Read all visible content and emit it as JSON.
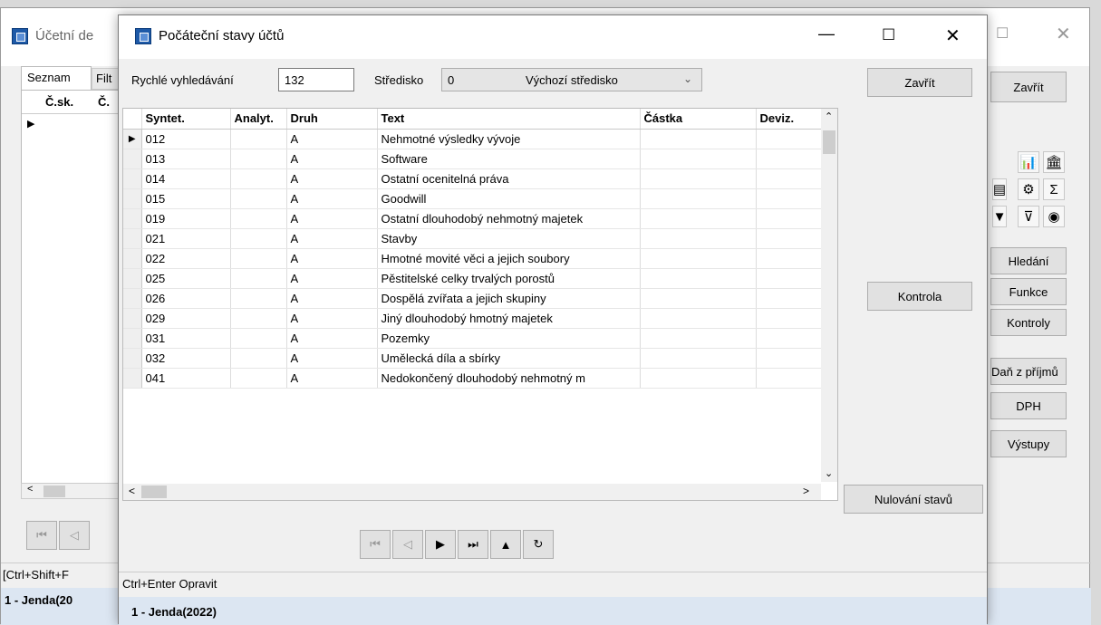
{
  "back_window": {
    "title": "Účetní de",
    "tabs": [
      "Seznam",
      "Filt"
    ],
    "col_headers": [
      "Č.sk.",
      "Č."
    ],
    "close_label": "Zavřít",
    "buttons": [
      "Hledání",
      "Funkce",
      "Kontroly",
      "Daň z příjmů",
      "DPH",
      "Výstupy"
    ],
    "status_hint": "[Ctrl+Shift+F",
    "status_user": "1 - Jenda(20",
    "icons": [
      "bar-chart-icon",
      "bank-icon",
      "list-icon",
      "gear-icon",
      "sum-icon",
      "filter-icon",
      "clear-filter-icon",
      "eye-icon"
    ]
  },
  "dialog": {
    "title": "Počáteční stavy účtů",
    "search_label": "Rychlé vyhledávání",
    "search_value": "132",
    "stredisko_label": "Středisko",
    "stredisko_code": "0",
    "stredisko_name": "Výchozí středisko",
    "close_label": "Zavřít",
    "kontrola_label": "Kontrola",
    "nulovani_label": "Nulování stavů",
    "status_hint": "Ctrl+Enter Opravit",
    "status_user": "1 - Jenda(2022)"
  },
  "grid": {
    "columns": [
      "Syntet.",
      "Analyt.",
      "Druh",
      "Text",
      "Částka",
      "Deviz."
    ],
    "rows": [
      [
        "012",
        "",
        "A",
        "Nehmotné výsledky vývoje",
        "",
        ""
      ],
      [
        "013",
        "",
        "A",
        "Software",
        "",
        ""
      ],
      [
        "014",
        "",
        "A",
        "Ostatní ocenitelná práva",
        "",
        ""
      ],
      [
        "015",
        "",
        "A",
        "Goodwill",
        "",
        ""
      ],
      [
        "019",
        "",
        "A",
        "Ostatní dlouhodobý nehmotný majetek",
        "",
        ""
      ],
      [
        "021",
        "",
        "A",
        "Stavby",
        "",
        ""
      ],
      [
        "022",
        "",
        "A",
        "Hmotné movité věci a jejich soubory",
        "",
        ""
      ],
      [
        "025",
        "",
        "A",
        "Pěstitelské celky trvalých porostů",
        "",
        ""
      ],
      [
        "026",
        "",
        "A",
        "Dospělá zvířata a jejich skupiny",
        "",
        ""
      ],
      [
        "029",
        "",
        "A",
        "Jiný dlouhodobý hmotný majetek",
        "",
        ""
      ],
      [
        "031",
        "",
        "A",
        "Pozemky",
        "",
        ""
      ],
      [
        "032",
        "",
        "A",
        "Umělecká díla a sbírky",
        "",
        ""
      ],
      [
        "041",
        "",
        "A",
        "Nedokončený dlouhodobý nehmotný m",
        "",
        ""
      ]
    ],
    "selected_row": 0
  },
  "nav": [
    {
      "name": "first-record-icon",
      "glyph": "⏮"
    },
    {
      "name": "prev-record-icon",
      "glyph": "◁"
    },
    {
      "name": "next-record-icon",
      "glyph": "▶"
    },
    {
      "name": "last-record-icon",
      "glyph": "⏭"
    },
    {
      "name": "up-icon",
      "glyph": "▲"
    },
    {
      "name": "refresh-icon",
      "glyph": "↻"
    }
  ]
}
